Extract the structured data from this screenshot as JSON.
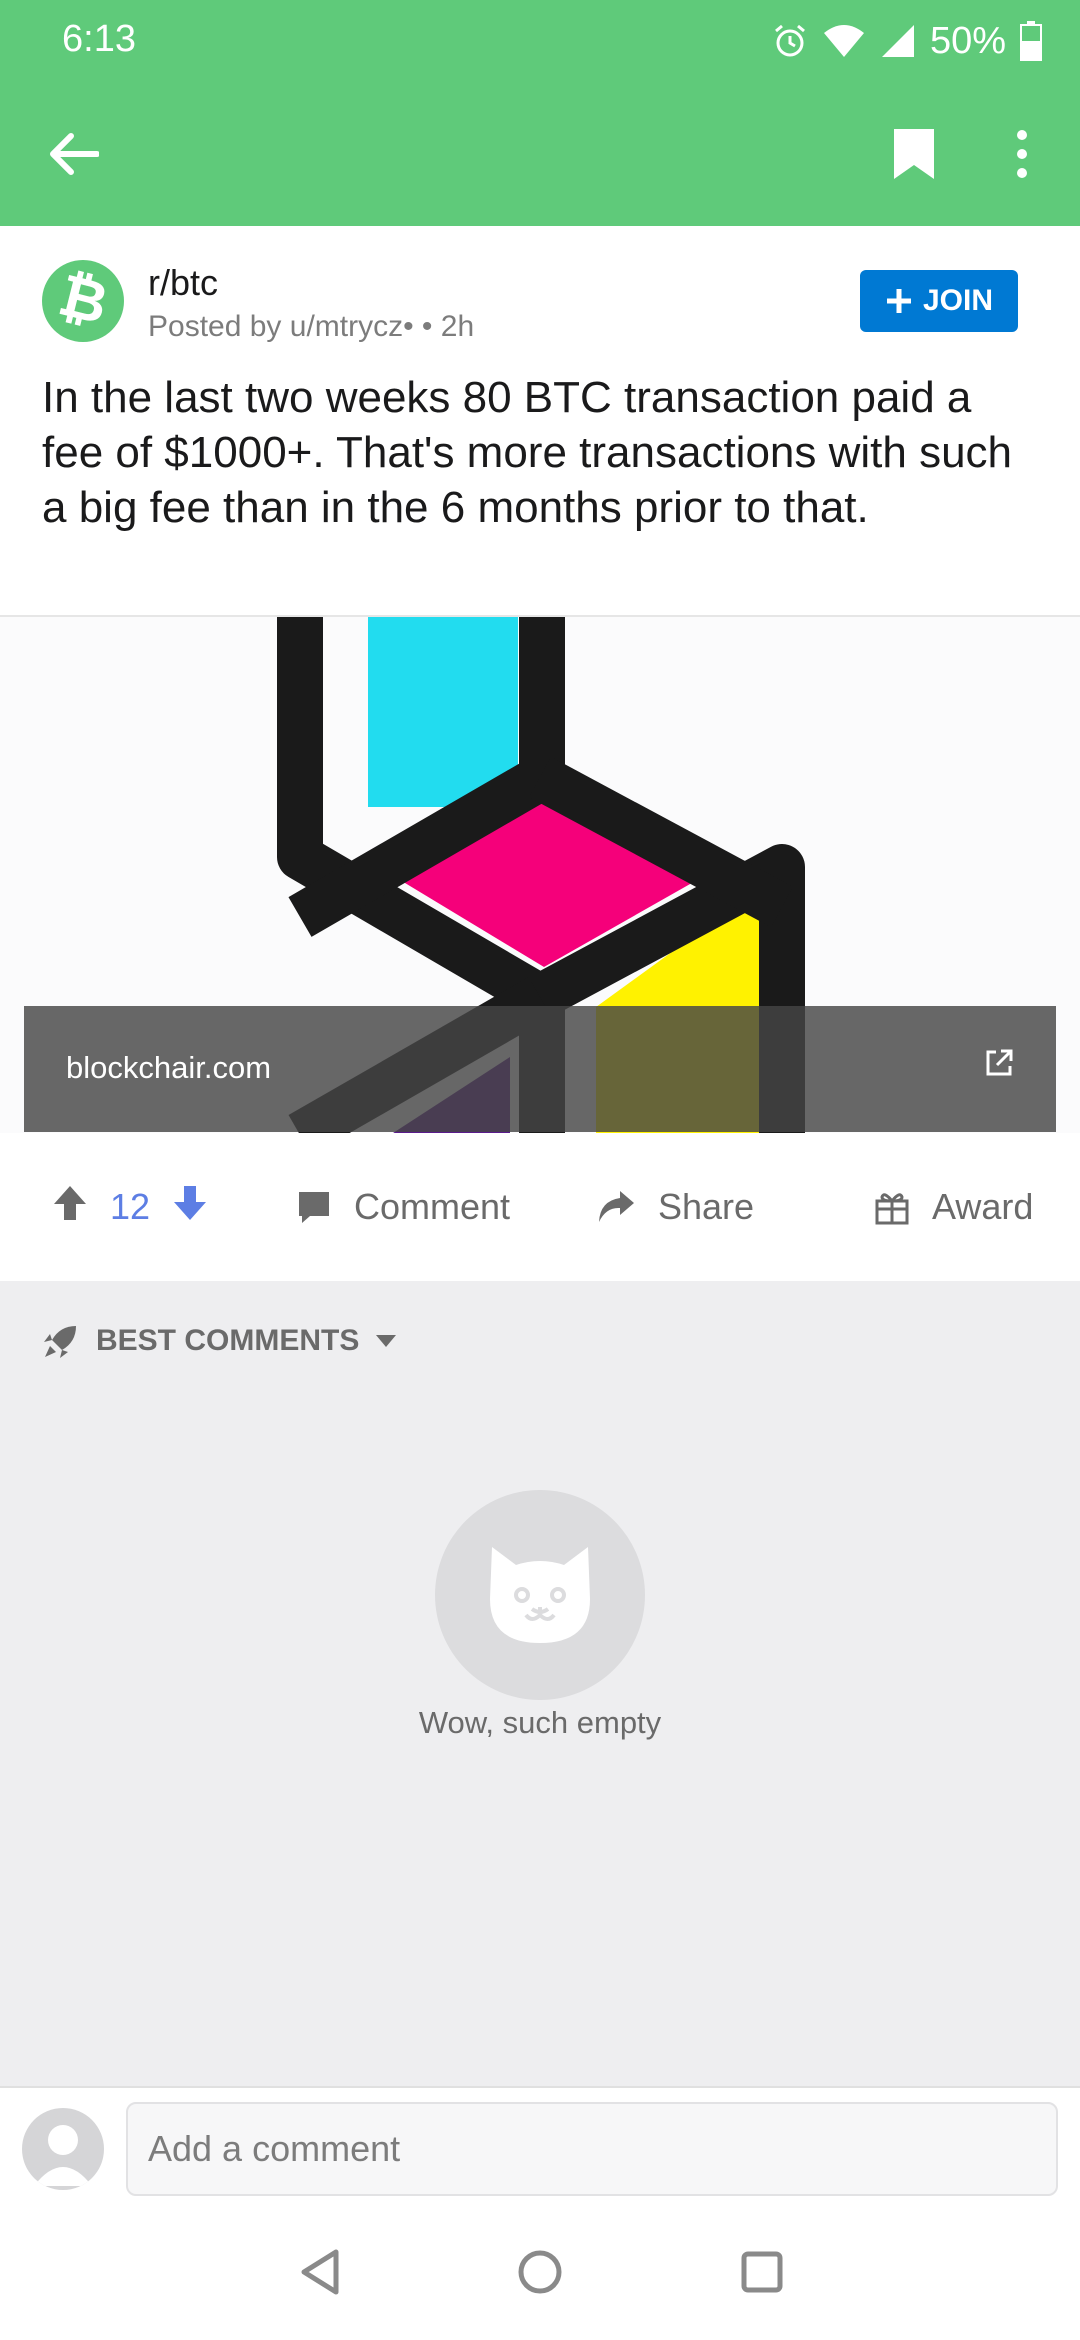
{
  "status": {
    "time": "6:13",
    "battery": "50%"
  },
  "post": {
    "subreddit": "r/btc",
    "posted_by": "Posted by u/mtrycz• • 2h",
    "join_label": "JOIN",
    "title": "In the last two weeks 80 BTC transaction paid a fee of $1000+. That's more transactions with such a big fee than in the 6 months prior to that.",
    "link_domain": "blockchair.com"
  },
  "actions": {
    "votes": "12",
    "comment_label": "Comment",
    "share_label": "Share",
    "award_label": "Award"
  },
  "comments": {
    "sort_label": "BEST COMMENTS",
    "empty_text": "Wow, such empty"
  },
  "composer": {
    "placeholder": "Add a comment"
  },
  "colors": {
    "accent_green": "#5fca7a",
    "join_blue": "#0079d3",
    "vote_blue": "#5d7ee4"
  }
}
